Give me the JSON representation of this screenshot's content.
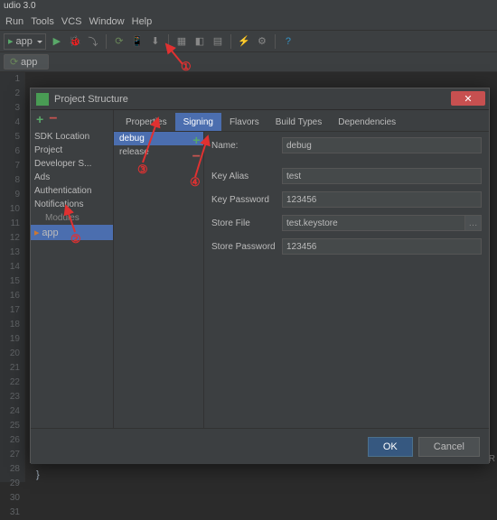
{
  "title_fragment": "udio 3.0",
  "menu": {
    "run": "Run",
    "tools": "Tools",
    "vcs": "VCS",
    "window": "Window",
    "help": "Help"
  },
  "toolbar": {
    "config": "app"
  },
  "breadcrumb": "app",
  "line_numbers": [
    "1",
    "2",
    "3",
    "4",
    "5",
    "6",
    "7",
    "8",
    "9",
    "10",
    "11",
    "12",
    "13",
    "14",
    "15",
    "16",
    "17",
    "18",
    "19",
    "20",
    "21",
    "22",
    "23",
    "24",
    "25",
    "26",
    "27",
    "28",
    "29",
    "30",
    "31"
  ],
  "dialog": {
    "title": "Project Structure",
    "left_items": [
      "SDK Location",
      "Project",
      "Developer S...",
      "Ads",
      "Authentication",
      "Notifications"
    ],
    "left_modules_label": "Modules",
    "left_module": "app",
    "tabs": [
      "Properties",
      "Signing",
      "Flavors",
      "Build Types",
      "Dependencies"
    ],
    "configs": [
      "debug",
      "release"
    ],
    "fields": {
      "name_label": "Name:",
      "name": "debug",
      "keyalias_label": "Key Alias",
      "keyalias": "test",
      "keypass_label": "Key Password",
      "keypass": "123456",
      "storefile_label": "Store File",
      "storefile": "test.keystore",
      "storepass_label": "Store Password",
      "storepass": "123456"
    },
    "ok": "OK",
    "cancel": "Cancel"
  },
  "annotations": {
    "a1": "①",
    "a2": "②",
    "a3": "③",
    "a4": "④"
  },
  "bottom_code": "}",
  "bottom_right": "nitR"
}
